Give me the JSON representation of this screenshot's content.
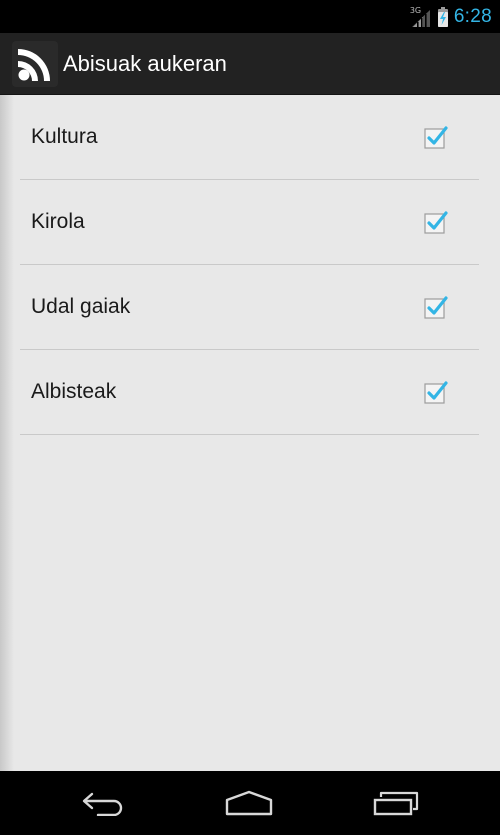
{
  "status_bar": {
    "network_label": "3G",
    "network_icon": "signal-icon",
    "battery_icon": "battery-charging-icon",
    "time": "6:28",
    "time_color": "#33b5e5"
  },
  "action_bar": {
    "icon": "rss-icon",
    "title": "Abisuak aukeran"
  },
  "preferences": [
    {
      "label": "Kultura",
      "checked": true
    },
    {
      "label": "Kirola",
      "checked": true
    },
    {
      "label": "Udal gaiak",
      "checked": true
    },
    {
      "label": "Albisteak",
      "checked": true
    }
  ],
  "checkbox_color": "#33b5e5",
  "nav_bar": {
    "back_icon": "back-icon",
    "home_icon": "home-icon",
    "recent_icon": "recent-apps-icon"
  }
}
